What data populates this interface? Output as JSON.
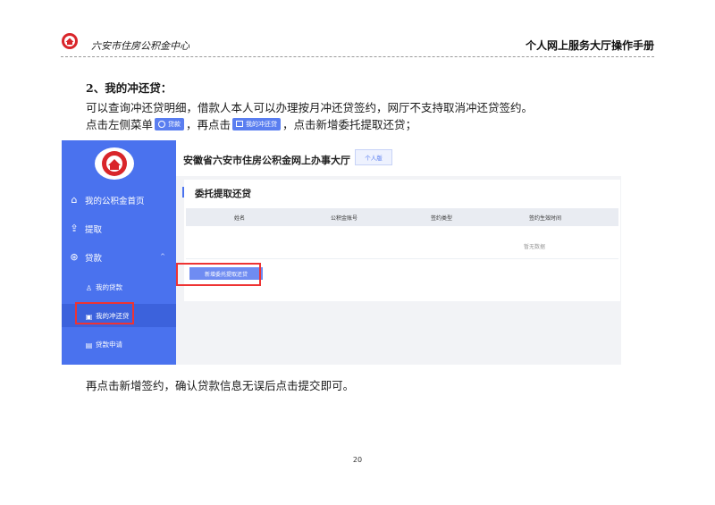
{
  "header": {
    "org_name": "六安市住房公积金中心",
    "doc_title": "个人网上服务大厅操作手册"
  },
  "content": {
    "section_title": "2、我的冲还贷：",
    "para1": "可以查询冲还贷明细，借款人本人可以办理按月冲还贷签约，网厅不支持取消冲还贷签约。",
    "para2_a": "点击左侧菜单",
    "chip_loan": "贷款",
    "para2_b": "，再点击",
    "chip_repay": "我的冲还贷",
    "para2_c": "，点击",
    "para2_bold": "新增委托提取还贷",
    "para2_d": "；",
    "para3_a": "再点击",
    "para3_b1": "新增签约",
    "para3_c": "，确认贷款信息无误后点击",
    "para3_b2": "提交",
    "para3_d": "即可。"
  },
  "screenshot": {
    "site_title": "安徽省六安市住房公积金网上办事大厅",
    "mode_button": "个人版",
    "sidebar": {
      "items": [
        {
          "label": "我的公积金首页",
          "icon": "home-icon"
        },
        {
          "label": "提取",
          "icon": "upload-icon"
        },
        {
          "label": "贷款",
          "icon": "coin-icon"
        }
      ],
      "sub_items": [
        {
          "label": "我的贷款",
          "icon": "person-icon"
        },
        {
          "label": "我的冲还贷",
          "icon": "repay-icon"
        },
        {
          "label": "贷款申请",
          "icon": "form-icon"
        }
      ]
    },
    "panel": {
      "title": "委托提取还贷",
      "columns": [
        "姓名",
        "公积金账号",
        "签约类型",
        "签约生效时间"
      ],
      "empty_text": "暂无数据",
      "add_button": "新增委托提取还贷"
    }
  },
  "footer": {
    "page_number": "20"
  },
  "colors": {
    "sidebar": "#4a72ee",
    "highlight_box": "#e33333",
    "logo_red": "#d9252a"
  }
}
